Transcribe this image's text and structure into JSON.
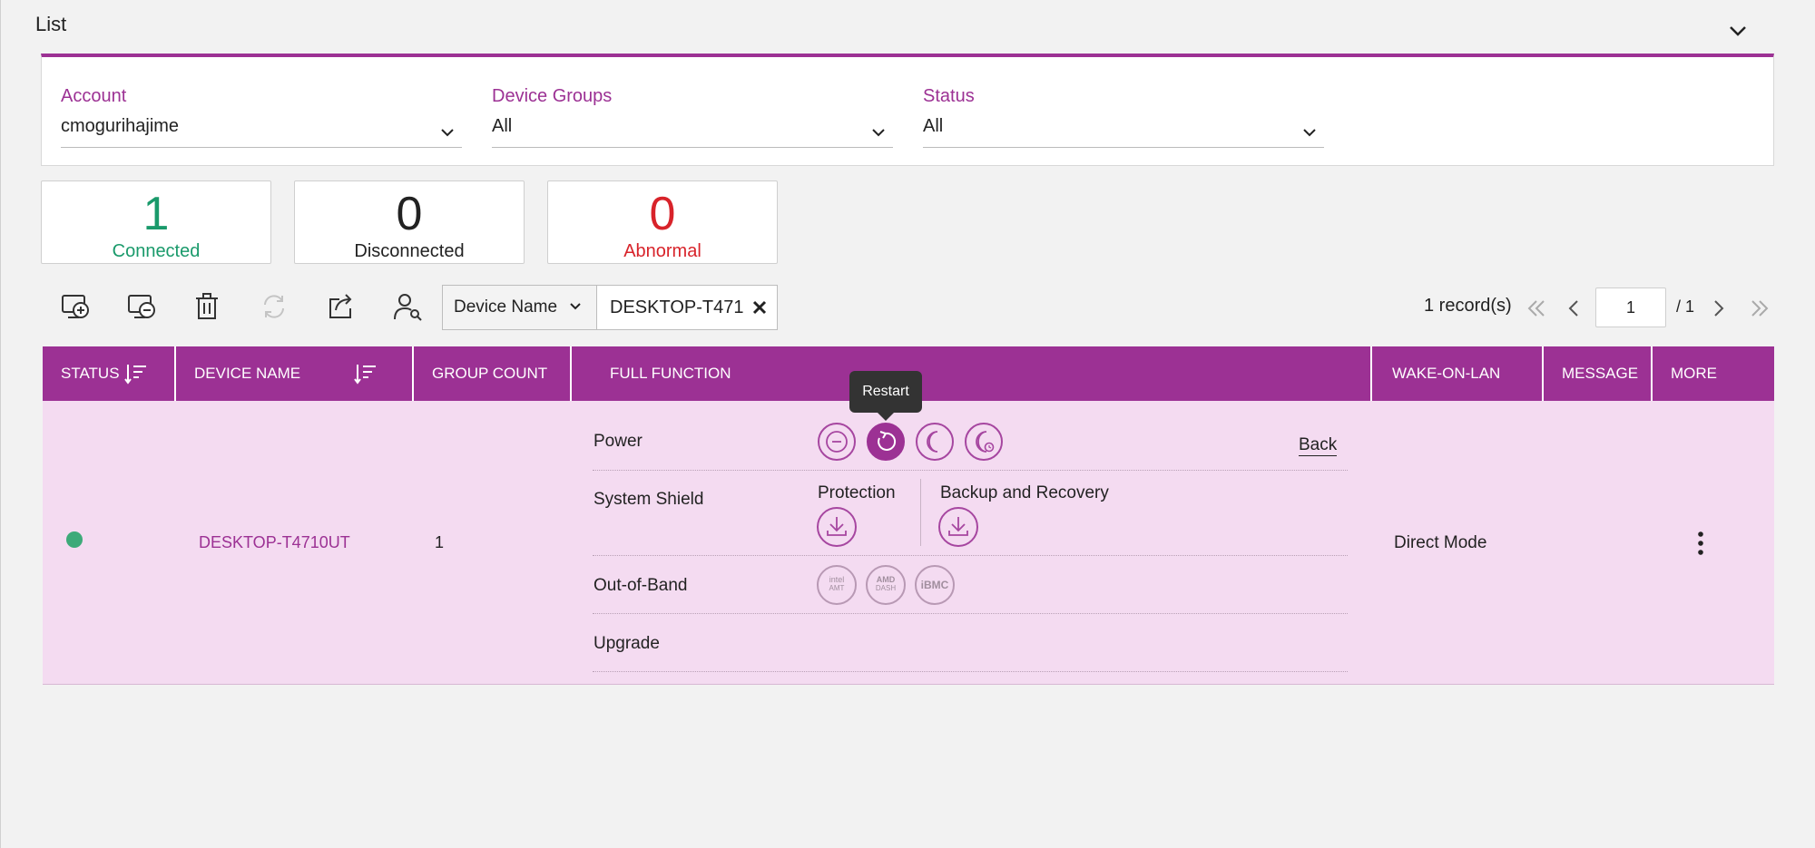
{
  "header": {
    "title": "List"
  },
  "filters": [
    {
      "label": "Account",
      "value": "cmogurihajime"
    },
    {
      "label": "Device Groups",
      "value": "All"
    },
    {
      "label": "Status",
      "value": "All"
    }
  ],
  "stats": [
    {
      "count": "1",
      "label": "Connected",
      "color": "#1a9a6b"
    },
    {
      "count": "0",
      "label": "Disconnected",
      "color": "#222222"
    },
    {
      "count": "0",
      "label": "Abnormal",
      "color": "#d8232a"
    }
  ],
  "toolbar": {
    "icons": [
      "add-device-icon",
      "remove-device-icon",
      "delete-icon",
      "refresh-icon",
      "export-icon",
      "user-search-icon"
    ]
  },
  "search": {
    "field": "Device Name",
    "value": "DESKTOP-T471"
  },
  "pagination": {
    "records": "1 record(s)",
    "page": "1",
    "total": "/ 1"
  },
  "table": {
    "columns": [
      "STATUS",
      "DEVICE NAME",
      "GROUP COUNT",
      "FULL FUNCTION",
      "WAKE-ON-LAN",
      "MESSAGE",
      "MORE"
    ],
    "row": {
      "status": "connected",
      "device_name": "DESKTOP-T4710UT",
      "group_count": "1",
      "wake_on_lan": "Direct Mode",
      "message": ""
    }
  },
  "full_function": {
    "power_label": "Power",
    "tooltip": "Restart",
    "back_label": "Back",
    "shield_label": "System Shield",
    "protection_label": "Protection",
    "backup_label": "Backup and Recovery",
    "oob_label": "Out-of-Band",
    "oob": [
      {
        "line1": "intel",
        "line2": "AMT"
      },
      {
        "line1": "AMD",
        "line2": "DASH"
      },
      {
        "line1": "iBMC",
        "line2": ""
      }
    ],
    "upgrade_label": "Upgrade"
  },
  "colors": {
    "accent": "#9c3194",
    "row_bg": "#f4dbf1",
    "connected_dot": "#3daa79"
  }
}
